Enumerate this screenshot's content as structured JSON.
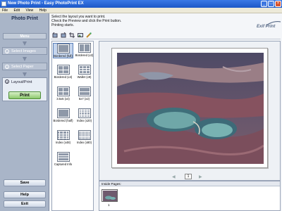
{
  "window": {
    "title": "New Photo Print - Easy PhotoPrint EX"
  },
  "menubar": {
    "items": [
      "File",
      "Edit",
      "View",
      "Help"
    ]
  },
  "sidebar": {
    "title": "Photo Print",
    "menu_label": "Menu",
    "steps": [
      {
        "num": "1",
        "label": "Select Images"
      },
      {
        "num": "2",
        "label": "Select Paper"
      },
      {
        "num": "3",
        "label": "Layout/Print"
      }
    ],
    "print_label": "Print",
    "save_label": "Save",
    "help_label": "Help",
    "exit_label": "Exit"
  },
  "main": {
    "instructions": [
      "Select the layout you want to print.",
      "Check the Preview and click the Print button.",
      "Printing starts."
    ],
    "logo_text": "Exif Print",
    "toolbar_icons": [
      "rotate-left-icon",
      "rotate-right-icon",
      "crop-icon",
      "image-edit-icon",
      "brush-icon"
    ],
    "layouts": [
      {
        "label": "Bordered (full)",
        "selected": true,
        "grid": "1x1"
      },
      {
        "label": "Bordered (x2)",
        "selected": false,
        "grid": "2x1"
      },
      {
        "label": "Bordered (x4)",
        "selected": false,
        "grid": "2x2"
      },
      {
        "label": "Wallet (x9)",
        "selected": false,
        "grid": "3x3"
      },
      {
        "label": "3.5x5 (x4)",
        "selected": false,
        "grid": "2x2"
      },
      {
        "label": "5x7 (x2)",
        "selected": false,
        "grid": "1x2"
      },
      {
        "label": "Bordered (half)",
        "selected": false,
        "grid": "1x1"
      },
      {
        "label": "Index (x20)",
        "selected": false,
        "grid": "4x5"
      },
      {
        "label": "Index (x48)",
        "selected": false,
        "grid": "6x8"
      },
      {
        "label": "Index (x80)",
        "selected": false,
        "grid": "8x10"
      },
      {
        "label": "Captured Info",
        "selected": false,
        "grid": "1x3"
      }
    ],
    "page_number": "1",
    "inside_pages_label": "Inside Pages:",
    "inside_page_num": "1"
  }
}
